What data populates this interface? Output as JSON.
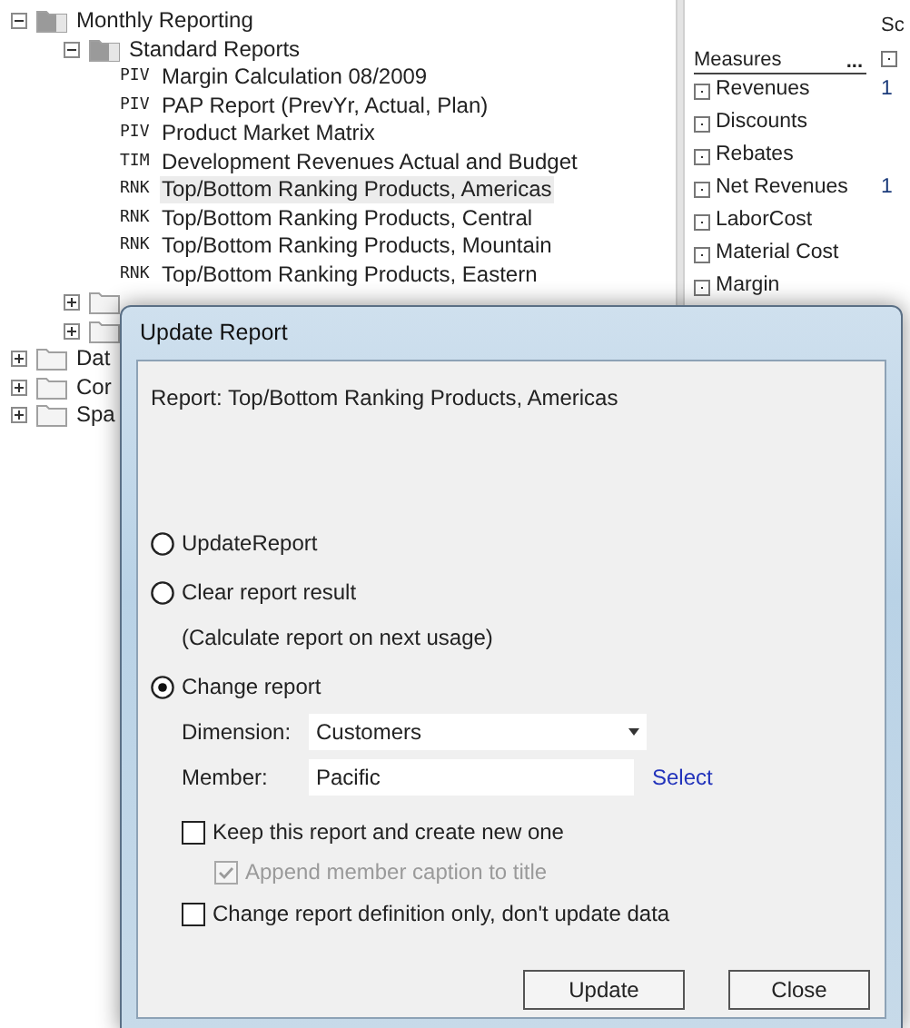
{
  "tree": {
    "items": [
      {
        "label": "Monthly Reporting",
        "kind": "folder",
        "expanded": true,
        "children": [
          {
            "label": "Standard Reports",
            "kind": "folder",
            "expanded": true,
            "children": [
              {
                "kind": "report",
                "code": "PIV",
                "label": "Margin Calculation 08/2009",
                "selected": false
              },
              {
                "kind": "report",
                "code": "PIV",
                "label": "PAP Report (PrevYr, Actual, Plan)",
                "selected": false
              },
              {
                "kind": "report",
                "code": "PIV",
                "label": "Product Market Matrix",
                "selected": false
              },
              {
                "kind": "report",
                "code": "TIM",
                "label": "Development Revenues Actual and Budget",
                "selected": false
              },
              {
                "kind": "report",
                "code": "RNK",
                "label": "Top/Bottom Ranking Products, Americas",
                "selected": true
              },
              {
                "kind": "report",
                "code": "RNK",
                "label": "Top/Bottom Ranking Products, Central",
                "selected": false
              },
              {
                "kind": "report",
                "code": "RNK",
                "label": "Top/Bottom Ranking Products, Mountain",
                "selected": false
              },
              {
                "kind": "report",
                "code": "RNK",
                "label": "Top/Bottom Ranking Products, Eastern",
                "selected": false
              }
            ]
          },
          {
            "kind": "folder",
            "expanded": false
          },
          {
            "kind": "folder",
            "expanded": false
          }
        ]
      },
      {
        "label": "Dat",
        "kind": "folder",
        "expanded": false
      },
      {
        "label": "Cor",
        "kind": "folder",
        "expanded": false
      },
      {
        "label": "Spa",
        "kind": "folder",
        "expanded": false
      }
    ]
  },
  "measures": {
    "header": "Measures",
    "menu": "...",
    "column_2_header": "Sc",
    "items": [
      {
        "label": "Revenues",
        "column_2": "1"
      },
      {
        "label": "Discounts"
      },
      {
        "label": "Rebates"
      },
      {
        "label": "Net Revenues",
        "column_2": "1"
      },
      {
        "label": "LaborCost"
      },
      {
        "label": "Material Cost"
      },
      {
        "label": "Margin"
      }
    ]
  },
  "dialog": {
    "title": "Update Report",
    "report": "Report: Top/Bottom Ranking Products, Americas",
    "options": [
      {
        "label": "UpdateReport",
        "selected": false
      },
      {
        "label": "Clear report result",
        "note": "(Calculate report on next usage)",
        "selected": false
      },
      {
        "label": "Change report",
        "selected": true
      }
    ],
    "dimension": {
      "label": "Dimension:",
      "value": "Customers"
    },
    "member": {
      "label": "Member:",
      "value": "Pacific",
      "link": "Select"
    },
    "checkboxes": [
      {
        "label": "Keep this report and create new one",
        "checked": false,
        "disabled": false,
        "children": [
          {
            "label": "Append member caption to title",
            "checked": true,
            "disabled": true
          }
        ]
      },
      {
        "label": "Change report definition only, don't update data",
        "checked": false,
        "disabled": false
      }
    ],
    "buttons": [
      "Update",
      "Close"
    ]
  }
}
